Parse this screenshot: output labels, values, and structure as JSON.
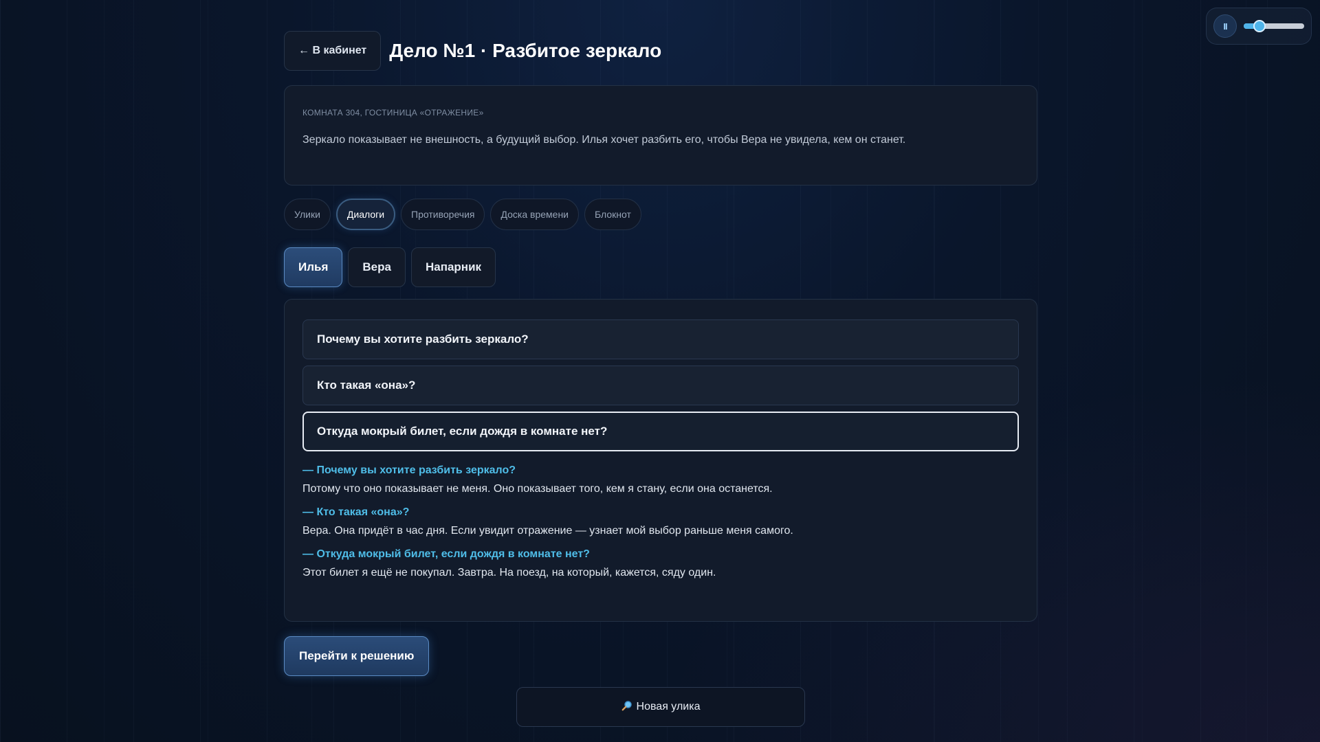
{
  "header": {
    "back_label": "← В кабинет",
    "title": "Дело №1 · Разбитое зеркало"
  },
  "audio": {
    "pause_glyph": "II",
    "volume": 0.2
  },
  "intro": {
    "location": "КОМНАТА 304, ГОСТИНИЦА «ОТРАЖЕНИЕ»",
    "text": "Зеркало показывает не внешность, а будущий выбор. Илья хочет разбить его, чтобы Вера не увидела, кем он станет."
  },
  "main_tabs": [
    {
      "label": "Улики",
      "active": false
    },
    {
      "label": "Диалоги",
      "active": true
    },
    {
      "label": "Противоречия",
      "active": false
    },
    {
      "label": "Доска времени",
      "active": false
    },
    {
      "label": "Блокнот",
      "active": false
    }
  ],
  "characters": [
    {
      "label": "Илья",
      "active": true
    },
    {
      "label": "Вера",
      "active": false
    },
    {
      "label": "Напарник",
      "active": false
    }
  ],
  "questions": [
    {
      "text": "Почему вы хотите разбить зеркало?",
      "selected": false
    },
    {
      "text": "Кто такая «она»?",
      "selected": false
    },
    {
      "text": "Откуда мокрый билет, если дождя в комнате нет?",
      "selected": true
    }
  ],
  "log": [
    {
      "q": "— Почему вы хотите разбить зеркало?",
      "a": "Потому что оно показывает не меня. Оно показывает того, кем я стану, если она останется."
    },
    {
      "q": "— Кто такая «она»?",
      "a": "Вера. Она придёт в час дня. Если увидит отражение — узнает мой выбор раньше меня самого."
    },
    {
      "q": "— Откуда мокрый билет, если дождя в комнате нет?",
      "a": "Этот билет я ещё не покупал. Завтра. На поезд, на который, кажется, сяду один."
    }
  ],
  "solve_label": "Перейти к решению",
  "toast": {
    "icon": "magnifier-icon",
    "label": "Новая улика"
  }
}
